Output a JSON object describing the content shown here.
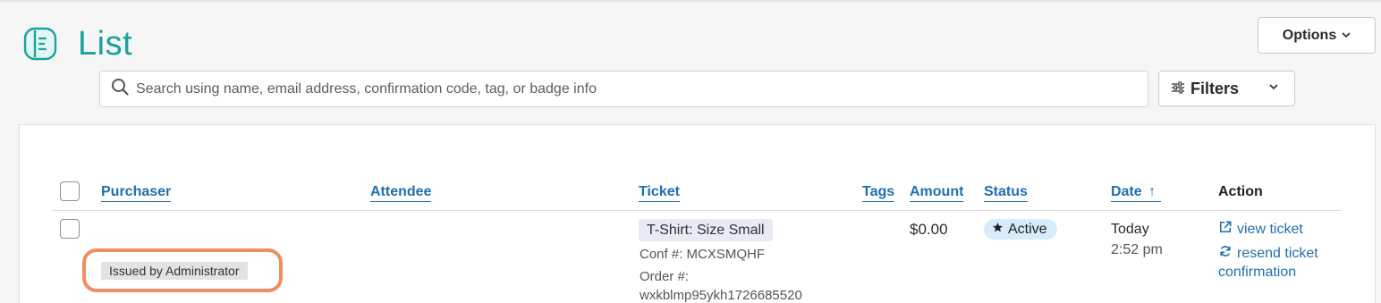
{
  "header": {
    "title": "List",
    "options_label": "Options"
  },
  "search": {
    "placeholder": "Search using name, email address, confirmation code, tag, or badge info"
  },
  "filters": {
    "label": "Filters"
  },
  "table": {
    "columns": {
      "purchaser": "Purchaser",
      "attendee": "Attendee",
      "ticket": "Ticket",
      "tags": "Tags",
      "amount": "Amount",
      "status": "Status",
      "date": "Date",
      "date_sort_indicator": "↑",
      "action": "Action"
    },
    "rows": [
      {
        "purchaser_tag": "Issued by Administrator",
        "ticket_name": "T-Shirt: Size Small",
        "conf": "Conf #: MCXSMQHF",
        "order_label": "Order #:",
        "order_value": "wxkblmp95ykh1726685520",
        "amount": "$0.00",
        "status": "Active",
        "date_day": "Today",
        "date_time": "2:52 pm",
        "action_view": "view ticket",
        "action_resend_line1": "resend ticket",
        "action_resend_line2": "confirmation"
      }
    ]
  },
  "colors": {
    "title_teal": "#1aa39a",
    "link_blue": "#1f6fb0",
    "highlight_orange": "#ef8d5e",
    "status_bg": "#d6ecfb"
  }
}
